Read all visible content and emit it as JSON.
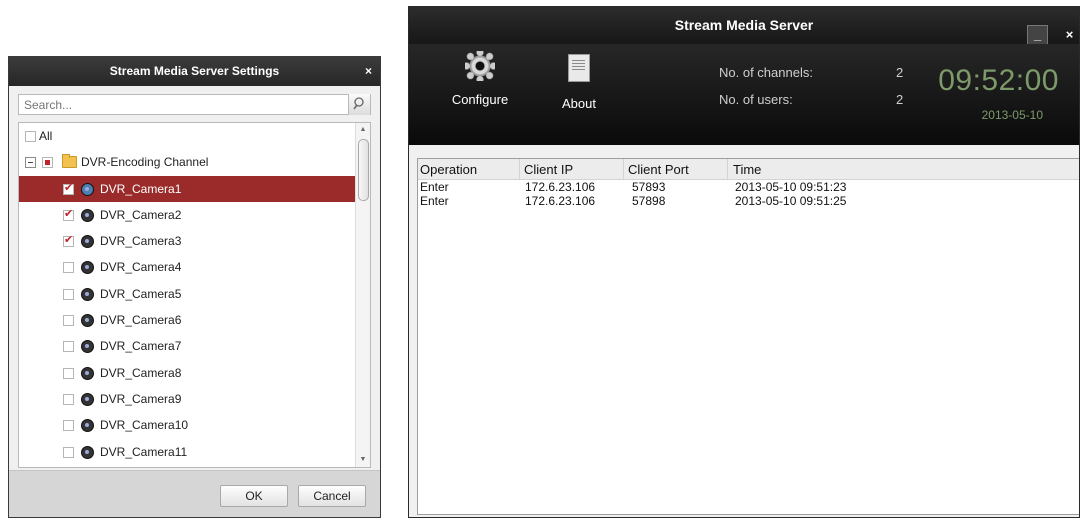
{
  "dialog": {
    "title": "Stream Media Server Settings",
    "close_label": "×",
    "search_placeholder": "Search...",
    "all_label": "All",
    "group_label": "DVR-Encoding Channel",
    "cameras": [
      {
        "label": "DVR_Camera1",
        "checked": true,
        "selected": true
      },
      {
        "label": "DVR_Camera2",
        "checked": true,
        "selected": false
      },
      {
        "label": "DVR_Camera3",
        "checked": true,
        "selected": false
      },
      {
        "label": "DVR_Camera4",
        "checked": false,
        "selected": false
      },
      {
        "label": "DVR_Camera5",
        "checked": false,
        "selected": false
      },
      {
        "label": "DVR_Camera6",
        "checked": false,
        "selected": false
      },
      {
        "label": "DVR_Camera7",
        "checked": false,
        "selected": false
      },
      {
        "label": "DVR_Camera8",
        "checked": false,
        "selected": false
      },
      {
        "label": "DVR_Camera9",
        "checked": false,
        "selected": false
      },
      {
        "label": "DVR_Camera10",
        "checked": false,
        "selected": false
      },
      {
        "label": "DVR_Camera11",
        "checked": false,
        "selected": false
      }
    ],
    "ok_label": "OK",
    "cancel_label": "Cancel"
  },
  "window": {
    "title": "Stream Media Server",
    "minimize_label": "_",
    "close_label": "×",
    "toolbar": {
      "configure_label": "Configure",
      "about_label": "About"
    },
    "stats": {
      "channels_label": "No. of channels:",
      "channels_value": "2",
      "users_label": "No. of users:",
      "users_value": "2"
    },
    "clock": {
      "time": "09:52:00",
      "date": "2013-05-10"
    },
    "table": {
      "columns": [
        "Operation",
        "Client IP",
        "Client Port",
        "Time"
      ],
      "rows": [
        [
          "Enter",
          "172.6.23.106",
          "57893",
          "2013-05-10 09:51:23"
        ],
        [
          "Enter",
          "172.6.23.106",
          "57898",
          "2013-05-10 09:51:25"
        ]
      ]
    }
  }
}
